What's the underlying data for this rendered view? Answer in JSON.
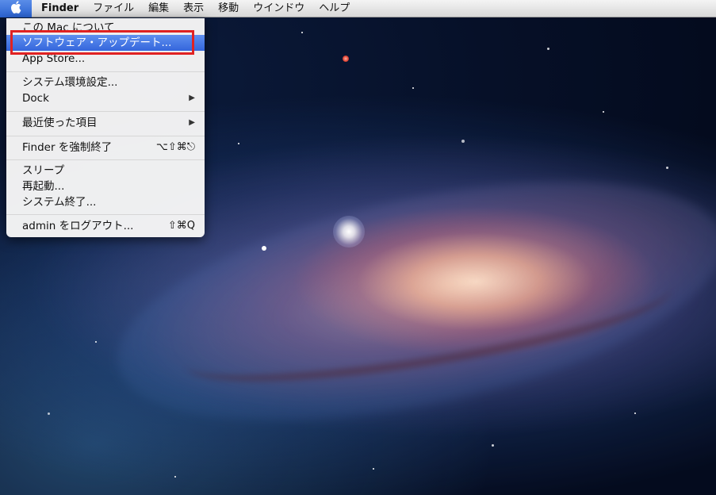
{
  "menubar": {
    "apple_label": "",
    "app_name": "Finder",
    "items": [
      "ファイル",
      "編集",
      "表示",
      "移動",
      "ウインドウ",
      "ヘルプ"
    ]
  },
  "apple_menu": {
    "items": [
      {
        "label": "この Mac について"
      },
      {
        "label": "ソフトウェア・アップデート..."
      },
      {
        "label": "App Store..."
      },
      {
        "label": "システム環境設定..."
      },
      {
        "label": "Dock"
      },
      {
        "label": "最近使った項目"
      },
      {
        "label": "Finder を強制終了",
        "shortcut": "⌥⇧⌘⎋"
      },
      {
        "label": "スリープ"
      },
      {
        "label": "再起動..."
      },
      {
        "label": "システム終了..."
      },
      {
        "label": "admin をログアウト...",
        "shortcut": "⇧⌘Q"
      }
    ],
    "submenu_arrow": "▶",
    "highlight_color": "#3466dc",
    "callout_color": "#e02222"
  }
}
